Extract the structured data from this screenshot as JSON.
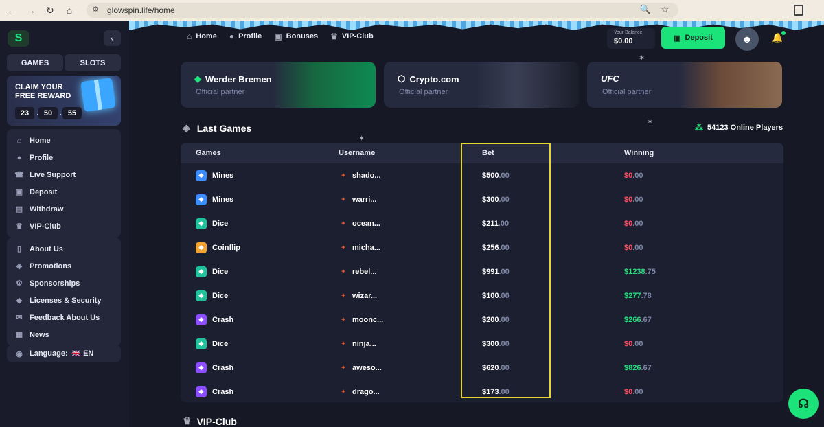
{
  "browser": {
    "url": "glowspin.life/home",
    "back_icon": "←",
    "forward_icon": "→",
    "reload_icon": "↻",
    "home_icon": "⌂",
    "zoom_icon": "🔍",
    "star_icon": "☆"
  },
  "sidebar": {
    "tabs": [
      "GAMES",
      "SLOTS"
    ],
    "reward": {
      "title": "CLAIM YOUR FREE REWARD",
      "hours": "23",
      "minutes": "50",
      "seconds": "55"
    },
    "menu1": [
      {
        "label": "Home",
        "icon": "⌂"
      },
      {
        "label": "Profile",
        "icon": "●"
      },
      {
        "label": "Live Support",
        "icon": "☎"
      },
      {
        "label": "Deposit",
        "icon": "▣"
      },
      {
        "label": "Withdraw",
        "icon": "▤"
      },
      {
        "label": "VIP-Club",
        "icon": "♛"
      }
    ],
    "menu2": [
      {
        "label": "About Us",
        "icon": "▯"
      },
      {
        "label": "Promotions",
        "icon": "◈"
      },
      {
        "label": "Sponsorships",
        "icon": "⚙"
      },
      {
        "label": "Licenses & Security",
        "icon": "◆"
      },
      {
        "label": "Feedback About Us",
        "icon": "✉"
      },
      {
        "label": "News",
        "icon": "▦"
      }
    ],
    "language": {
      "label": "Language:",
      "value": "EN",
      "flag": "🇬🇧"
    }
  },
  "header": {
    "nav": [
      {
        "label": "Home",
        "icon": "⌂"
      },
      {
        "label": "Profile",
        "icon": "●"
      },
      {
        "label": "Bonuses",
        "icon": "▣"
      },
      {
        "label": "VIP-Club",
        "icon": "♛"
      }
    ],
    "balance_label": "Your Balance",
    "balance_value": "$0.00",
    "deposit_label": "Deposit"
  },
  "partners": [
    {
      "name": "Werder Bremen",
      "sub": "Official partner"
    },
    {
      "name": "Crypto.com",
      "sub": "Official partner"
    },
    {
      "name": "UFC",
      "sub": "Official partner"
    }
  ],
  "last_games": {
    "title": "Last Games",
    "online": "54123 Online Players",
    "columns": [
      "Games",
      "Username",
      "Bet",
      "Winning"
    ],
    "rows": [
      {
        "game": "Mines",
        "user": "shado...",
        "bet": "$500",
        "bet_c": ".00",
        "win": "$0",
        "win_c": ".00",
        "status": "loss",
        "color": "#3b8cff"
      },
      {
        "game": "Mines",
        "user": "warri...",
        "bet": "$300",
        "bet_c": ".00",
        "win": "$0",
        "win_c": ".00",
        "status": "loss",
        "color": "#3b8cff"
      },
      {
        "game": "Dice",
        "user": "ocean...",
        "bet": "$211",
        "bet_c": ".00",
        "win": "$0",
        "win_c": ".00",
        "status": "loss",
        "color": "#1fc29a"
      },
      {
        "game": "Coinflip",
        "user": "micha...",
        "bet": "$256",
        "bet_c": ".00",
        "win": "$0",
        "win_c": ".00",
        "status": "loss",
        "color": "#f0a431"
      },
      {
        "game": "Dice",
        "user": "rebel...",
        "bet": "$991",
        "bet_c": ".00",
        "win": "$1238",
        "win_c": ".75",
        "status": "win",
        "color": "#1fc29a"
      },
      {
        "game": "Dice",
        "user": "wizar...",
        "bet": "$100",
        "bet_c": ".00",
        "win": "$277",
        "win_c": ".78",
        "status": "win",
        "color": "#1fc29a"
      },
      {
        "game": "Crash",
        "user": "moonc...",
        "bet": "$200",
        "bet_c": ".00",
        "win": "$266",
        "win_c": ".67",
        "status": "win",
        "color": "#8b4dff"
      },
      {
        "game": "Dice",
        "user": "ninja...",
        "bet": "$300",
        "bet_c": ".00",
        "win": "$0",
        "win_c": ".00",
        "status": "loss",
        "color": "#1fc29a"
      },
      {
        "game": "Crash",
        "user": "aweso...",
        "bet": "$620",
        "bet_c": ".00",
        "win": "$826",
        "win_c": ".67",
        "status": "win",
        "color": "#8b4dff"
      },
      {
        "game": "Crash",
        "user": "drago...",
        "bet": "$173",
        "bet_c": ".00",
        "win": "$0",
        "win_c": ".00",
        "status": "loss",
        "color": "#8b4dff"
      }
    ]
  },
  "vip_title": "VIP-Club"
}
